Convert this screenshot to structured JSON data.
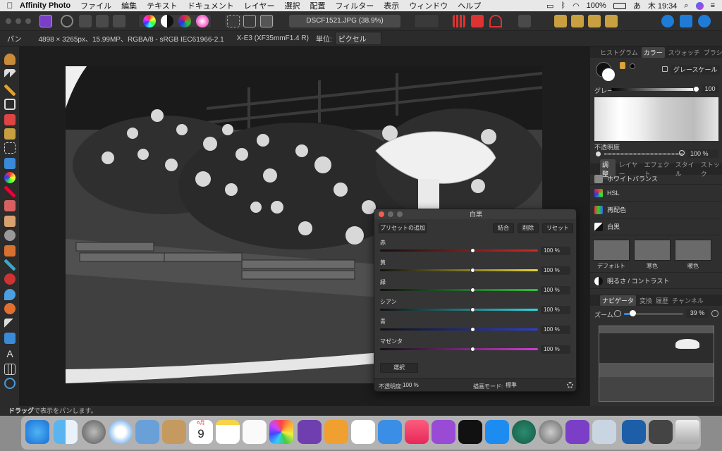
{
  "menubar": {
    "app": "Affinity Photo",
    "items": [
      "ファイル",
      "編集",
      "テキスト",
      "ドキュメント",
      "レイヤー",
      "選択",
      "配置",
      "フィルター",
      "表示",
      "ウィンドウ",
      "ヘルプ"
    ],
    "battery": "100%",
    "clock": "木 19:34"
  },
  "toolbar": {
    "doc_tab": "DSCF1521.JPG (38.9%)"
  },
  "context": {
    "tool": "パン",
    "info": "4898 × 3265px、15.99MP、RGBA/8 - sRGB IEC61966-2.1",
    "camera": "X-E3 (XF35mmF1.4 R)",
    "unit_label": "単位:",
    "unit_value": "ピクセル"
  },
  "colors": {
    "red": "#cc2a2a",
    "yellow": "#e6d430",
    "green": "#2ec43a",
    "cyan": "#2fd8e0",
    "blue": "#2a3ee0",
    "magenta": "#d43ad8",
    "dialog_close": "#ef5f55"
  },
  "rpanel": {
    "top_tabs": [
      "ヒストグラム",
      "カラー",
      "スウォッチ",
      "ブラシ"
    ],
    "color_mode": "グレースケール",
    "gray_label": "グレー",
    "gray_value": "100",
    "opacity_label": "不透明度",
    "opacity_value": "100 %",
    "adj_tabs": [
      "調整",
      "レイヤー",
      "エフェクト",
      "スタイル",
      "ストック"
    ],
    "adjustments": [
      "ホワイトバランス",
      "HSL",
      "再配色",
      "白黒"
    ],
    "presets": [
      "デフォルト",
      "寒色",
      "暖色"
    ],
    "brightness": "明るさ / コントラスト",
    "nav_tabs": [
      "ナビゲータ",
      "変換",
      "履歴",
      "チャンネル"
    ],
    "zoom_label": "ズーム:",
    "zoom_value": "39 %"
  },
  "dialog": {
    "title": "白黒",
    "add_preset": "プリセットの追加",
    "merge": "結合",
    "delete": "削除",
    "reset": "リセット",
    "sliders": [
      {
        "label": "赤",
        "value": "100 %"
      },
      {
        "label": "黄",
        "value": "100 %"
      },
      {
        "label": "緑",
        "value": "100 %"
      },
      {
        "label": "シアン",
        "value": "100 %"
      },
      {
        "label": "青",
        "value": "100 %"
      },
      {
        "label": "マゼンタ",
        "value": "100 %"
      }
    ],
    "select": "選択",
    "opacity_label": "不透明度:",
    "opacity_value": "100 %",
    "blend_label": "描画モード:",
    "blend_value": "標準"
  },
  "status": {
    "bold": "ドラッグ",
    "rest": "で表示をパンします。"
  },
  "dock": {
    "calendar_month": "6月",
    "calendar_day": "9"
  }
}
